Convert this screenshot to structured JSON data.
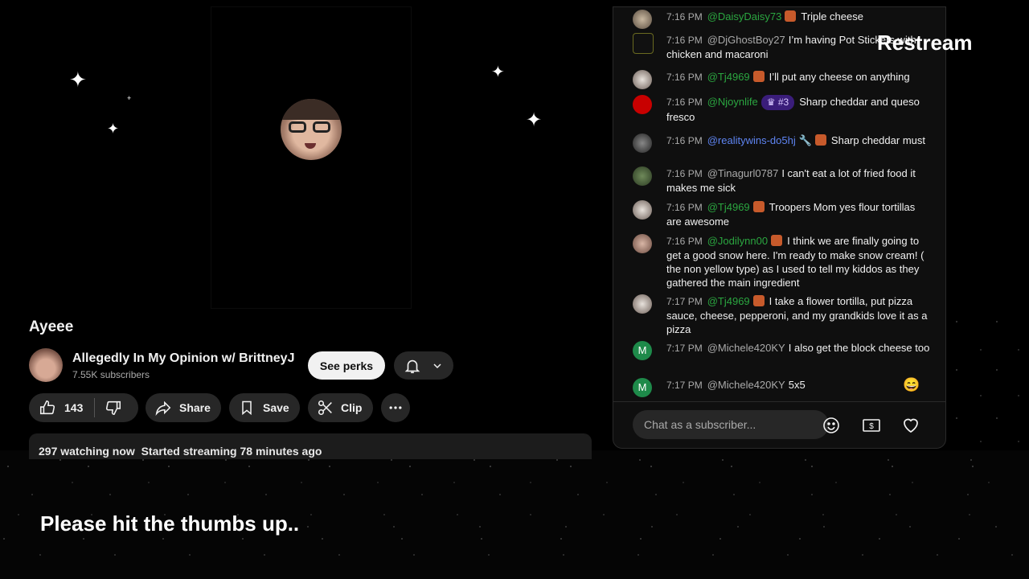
{
  "branding": {
    "restream": "Restream"
  },
  "video": {
    "title": "Ayeee"
  },
  "channel": {
    "name": "Allegedly In My Opinion w/ BrittneyJ",
    "subscribers": "7.55K subscribers",
    "see_perks": "See perks"
  },
  "actions": {
    "like_count": "143",
    "share": "Share",
    "save": "Save",
    "clip": "Clip"
  },
  "description": {
    "stats": "297 watching now  Started streaming 78 minutes ago"
  },
  "overlay": {
    "caption": "Please hit the thumbs up.."
  },
  "chat": {
    "input_placeholder": "Chat as a subscriber...",
    "messages": [
      {
        "time": "7:16 PM",
        "author": "@DaisyDaisy73",
        "text": "Triple cheese",
        "author_color": "#2ba640"
      },
      {
        "time": "7:16 PM",
        "author": "@DjGhostBoy27",
        "text": "I’m having Pot Stickers with chicken and macaroni",
        "author_color": "#aaaaaa"
      },
      {
        "time": "7:16 PM",
        "author": "@Tj4969",
        "text": "I’ll put any cheese on anything",
        "author_color": "#2ba640"
      },
      {
        "time": "7:16 PM",
        "author": "@Njoynlife",
        "rank": "#3",
        "text": "Sharp cheddar and queso fresco",
        "author_color": "#2ba640"
      },
      {
        "time": "7:16 PM",
        "author": "@realitywins-do5hj",
        "text": "Sharp cheddar must",
        "author_color": "#5e84f1"
      },
      {
        "time": "7:16 PM",
        "author": "@Tinagurl0787",
        "text": "I can't eat a lot of fried food it makes me sick",
        "author_color": "#aaaaaa"
      },
      {
        "time": "7:16 PM",
        "author": "@Tj4969",
        "text": "Troopers Mom yes flour tortillas are awesome",
        "author_color": "#2ba640"
      },
      {
        "time": "7:16 PM",
        "author": "@Jodilynn00",
        "text": "I think we are finally going to get a good snow here. I'm ready to make snow cream! ( the non yellow type) as I used to tell my kiddos as they gathered the main ingredient",
        "author_color": "#2ba640"
      },
      {
        "time": "7:17 PM",
        "author": "@Tj4969",
        "text": "I take a flower tortilla, put pizza sauce, cheese, pepperoni, and my grandkids love it as a pizza",
        "author_color": "#2ba640"
      },
      {
        "time": "7:17 PM",
        "author": "@Michele420KY",
        "text": "I also get the block cheese too",
        "author_color": "#aaaaaa",
        "avatar_letter": "M"
      },
      {
        "time": "7:17 PM",
        "author": "@Michele420KY",
        "text": "5x5",
        "author_color": "#aaaaaa",
        "avatar_letter": "M"
      }
    ]
  }
}
